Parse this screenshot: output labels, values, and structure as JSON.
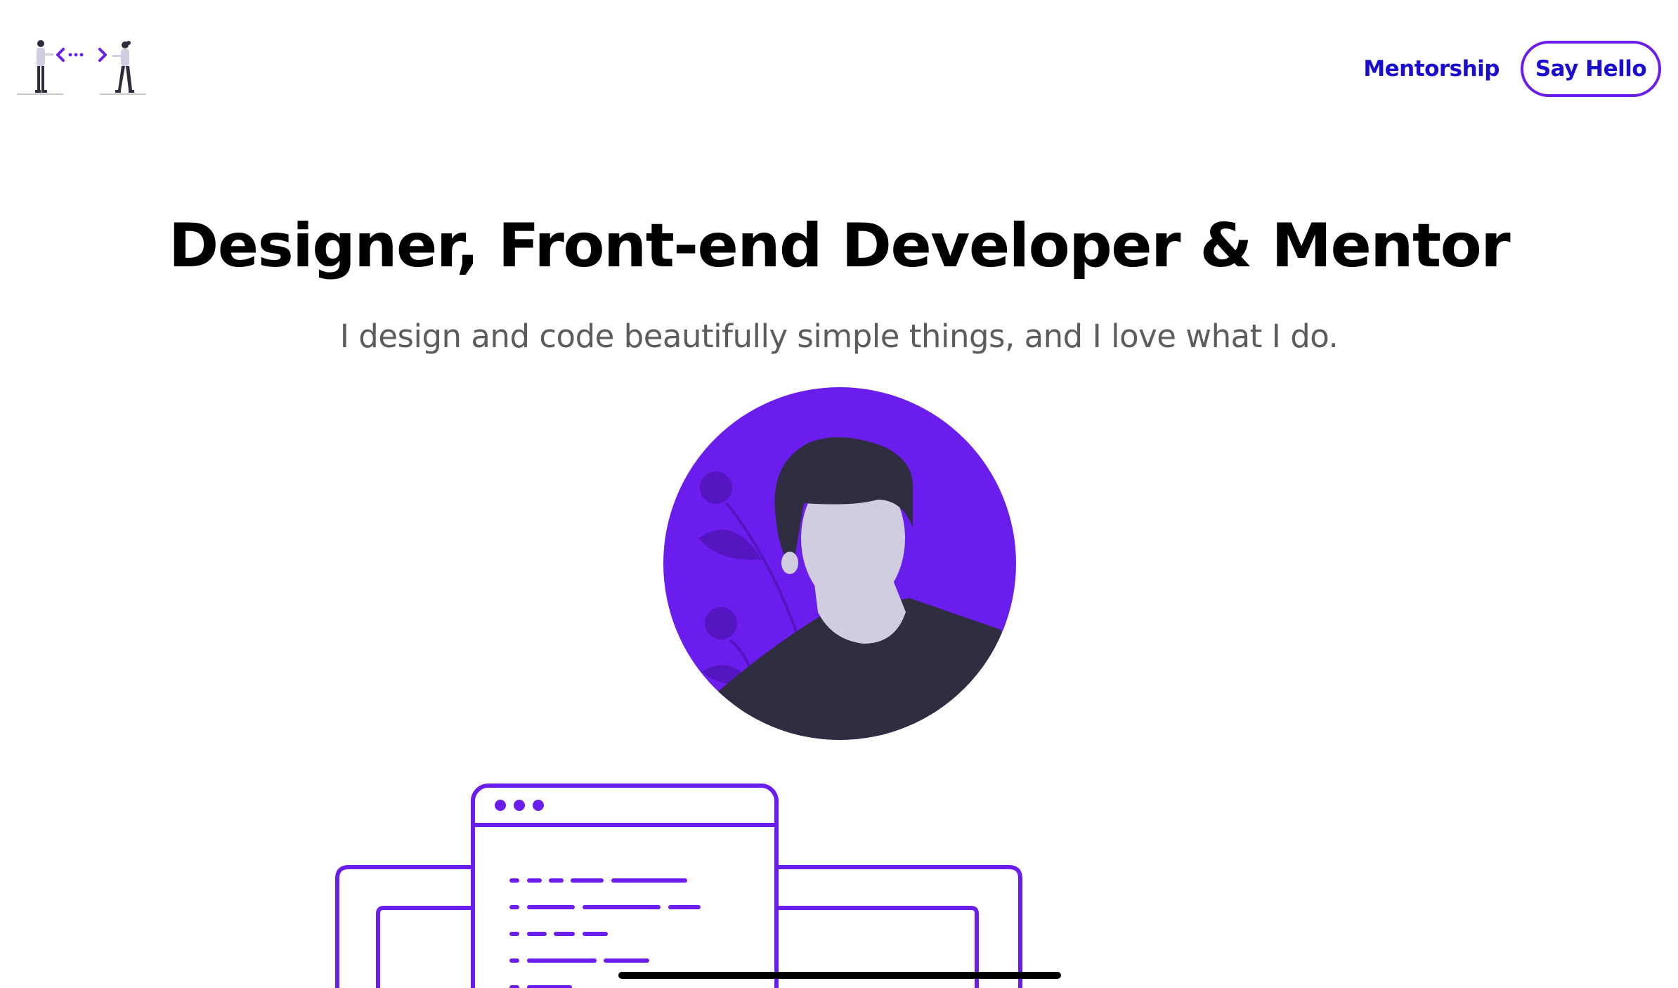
{
  "header": {
    "logo_icon": "two-people-code-brackets-illustration",
    "nav": {
      "mentorship_label": "Mentorship",
      "say_hello_label": "Say Hello"
    }
  },
  "hero": {
    "headline": "Designer, Front-end Developer & Mentor",
    "subheadline": "I design and code beautifully simple things, and I love what I do.",
    "avatar_icon": "person-avatar-illustration",
    "devices_icon": "browser-and-laptop-illustration"
  },
  "colors": {
    "accent": "#6b1ded",
    "link": "#1a0dd1",
    "dark": "#2f2e41",
    "skin": "#d0cde1",
    "subtle_text": "#5c5c5c"
  }
}
